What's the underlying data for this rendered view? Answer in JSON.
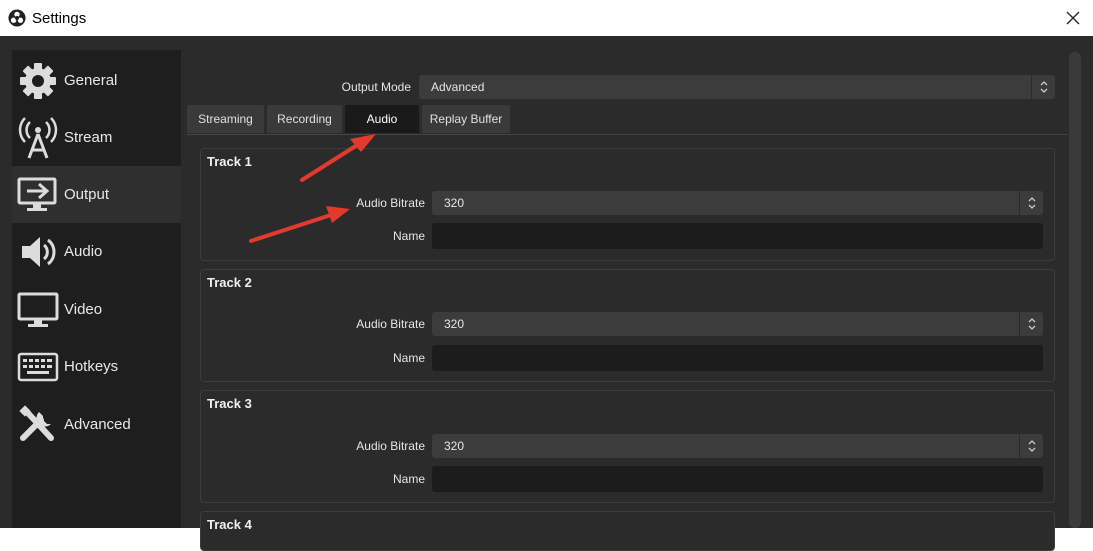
{
  "window": {
    "title": "Settings"
  },
  "sidebar": {
    "items": [
      {
        "label": "General",
        "icon": "gear-icon"
      },
      {
        "label": "Stream",
        "icon": "antenna-icon"
      },
      {
        "label": "Output",
        "icon": "output-icon",
        "active": true
      },
      {
        "label": "Audio",
        "icon": "speaker-icon"
      },
      {
        "label": "Video",
        "icon": "monitor-icon"
      },
      {
        "label": "Hotkeys",
        "icon": "keyboard-icon"
      },
      {
        "label": "Advanced",
        "icon": "tools-icon"
      }
    ]
  },
  "output": {
    "mode_label": "Output Mode",
    "mode_value": "Advanced",
    "tabs": [
      {
        "label": "Streaming"
      },
      {
        "label": "Recording"
      },
      {
        "label": "Audio",
        "active": true
      },
      {
        "label": "Replay Buffer"
      }
    ],
    "tracks": [
      {
        "title": "Track 1",
        "bitrate_label": "Audio Bitrate",
        "bitrate": "320",
        "name_label": "Name",
        "name": ""
      },
      {
        "title": "Track 2",
        "bitrate_label": "Audio Bitrate",
        "bitrate": "320",
        "name_label": "Name",
        "name": ""
      },
      {
        "title": "Track 3",
        "bitrate_label": "Audio Bitrate",
        "bitrate": "320",
        "name_label": "Name",
        "name": ""
      },
      {
        "title": "Track 4"
      }
    ]
  },
  "colors": {
    "window_bg": "#2b2b2b",
    "sidebar_bg": "#1e1e1e",
    "annotation_arrow": "#e23b2e"
  }
}
